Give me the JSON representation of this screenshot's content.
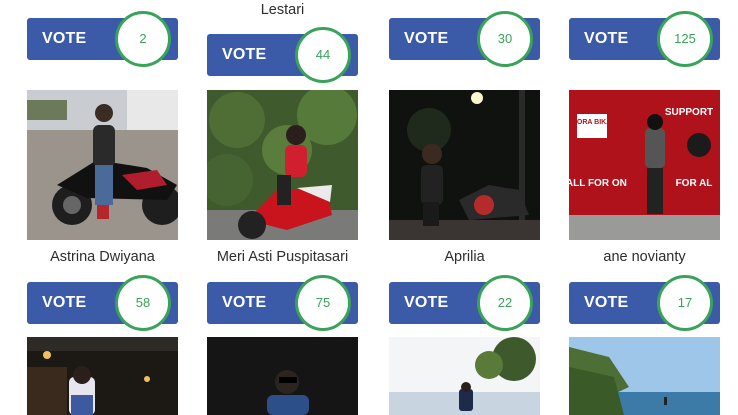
{
  "vote_label": "VOTE",
  "accent_color": "#3b5ba8",
  "count_color": "#39a35a",
  "top_row": {
    "captions": [
      "",
      "Lestari",
      "",
      ""
    ],
    "votes": [
      "2",
      "44",
      "30",
      "125"
    ]
  },
  "middle_row": {
    "captions": [
      "Astrina Dwiyana",
      "Meri Asti Puspitasari",
      "Aprilia",
      "ane novianty"
    ],
    "votes": [
      "58",
      "75",
      "22",
      "17"
    ],
    "photos": [
      "motorbike-photo",
      "motorbike-photo",
      "night-motorbike-photo",
      "banner-photo"
    ]
  },
  "banner_photo_text": [
    "TORA BIKA",
    "SUPPORT",
    "\"ALL FOR ON",
    "FOR AL"
  ],
  "bottom_row": {
    "photos": [
      "night-street-photo",
      "dark-portrait-photo",
      "sky-photo",
      "beach-photo"
    ]
  }
}
